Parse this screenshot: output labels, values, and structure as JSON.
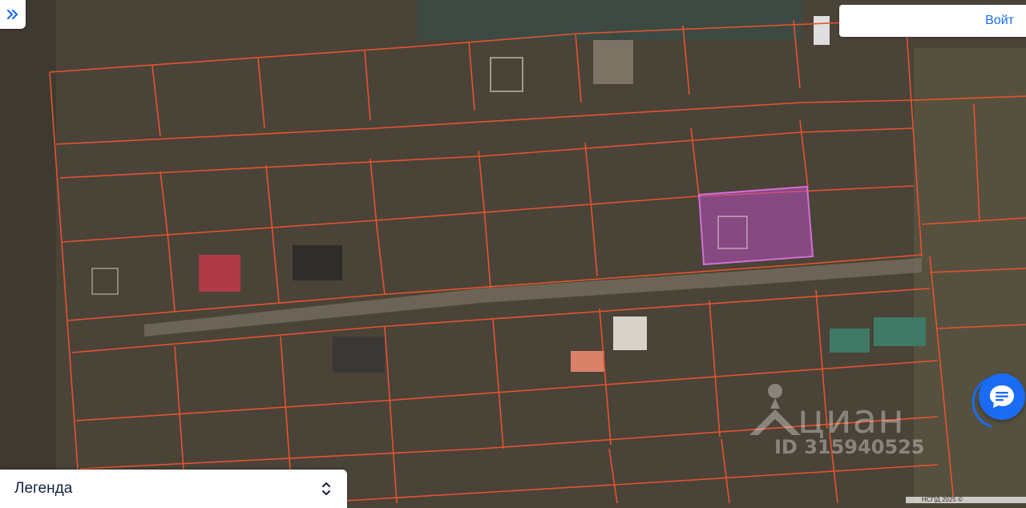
{
  "header": {
    "expand_icon": "double-chevron-right-icon",
    "login_label": "Войт"
  },
  "legend": {
    "label": "Легенда",
    "toggle_icon": "chevron-up-down-icon"
  },
  "watermark": {
    "brand": "циан",
    "id_text": "ID 315940525"
  },
  "attribution": {
    "text": "НСПД 2025 ©"
  },
  "chat": {
    "icon": "chat-bubble-icon"
  },
  "colors": {
    "accent": "#1a6cf5",
    "parcel_border": "#e5532f",
    "highlight": "#b84fbf",
    "terrain": "#4a4337",
    "road": "#7a7264"
  }
}
